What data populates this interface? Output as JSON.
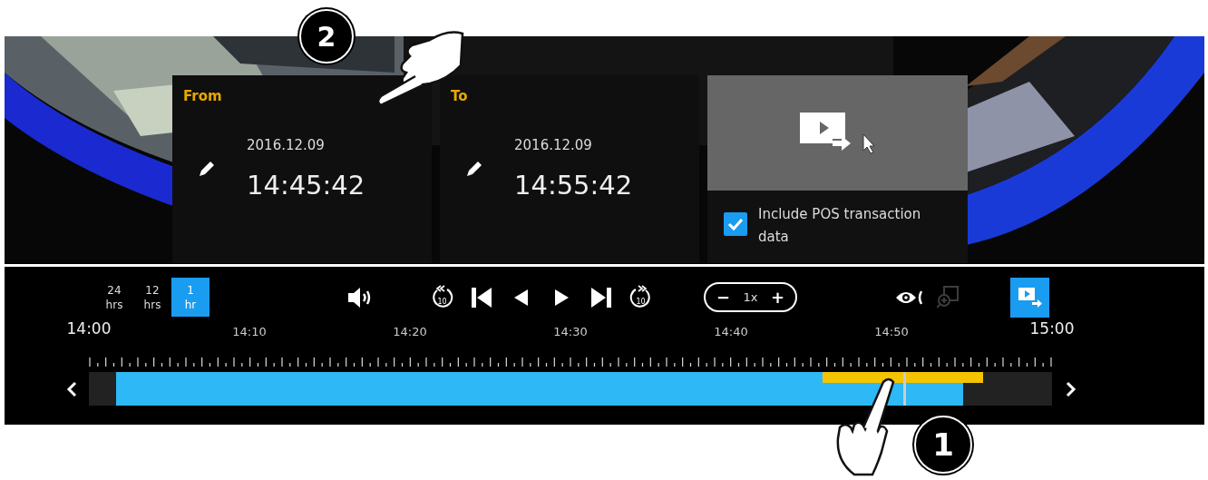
{
  "range": {
    "from": {
      "label": "From",
      "date": "2016.12.09",
      "time": "14:45:42"
    },
    "to": {
      "label": "To",
      "date": "2016.12.09",
      "time": "14:55:42"
    }
  },
  "export_panel": {
    "include_pos": {
      "label": "Include POS transaction data",
      "checked": true
    }
  },
  "zoom_levels": [
    {
      "label": "24 hrs",
      "selected": false
    },
    {
      "label": "12 hrs",
      "selected": false
    },
    {
      "label": "1 hr",
      "selected": true
    }
  ],
  "rewind": {
    "seconds": "10"
  },
  "forward": {
    "seconds": "10"
  },
  "speed": {
    "decrease": "−",
    "value": "1x",
    "increase": "+"
  },
  "region_zoom": {
    "disabled": true
  },
  "export_mode": {
    "selected": true
  },
  "timeline": {
    "start_label": "14:00",
    "end_label": "15:00",
    "ticks": [
      "14:10",
      "14:20",
      "14:30",
      "14:40",
      "14:50"
    ],
    "recording": {
      "level": 0.908
    },
    "playhead": {
      "level": 0.846
    }
  },
  "callouts": [
    {
      "number": "2"
    },
    {
      "number": "1"
    }
  ]
}
